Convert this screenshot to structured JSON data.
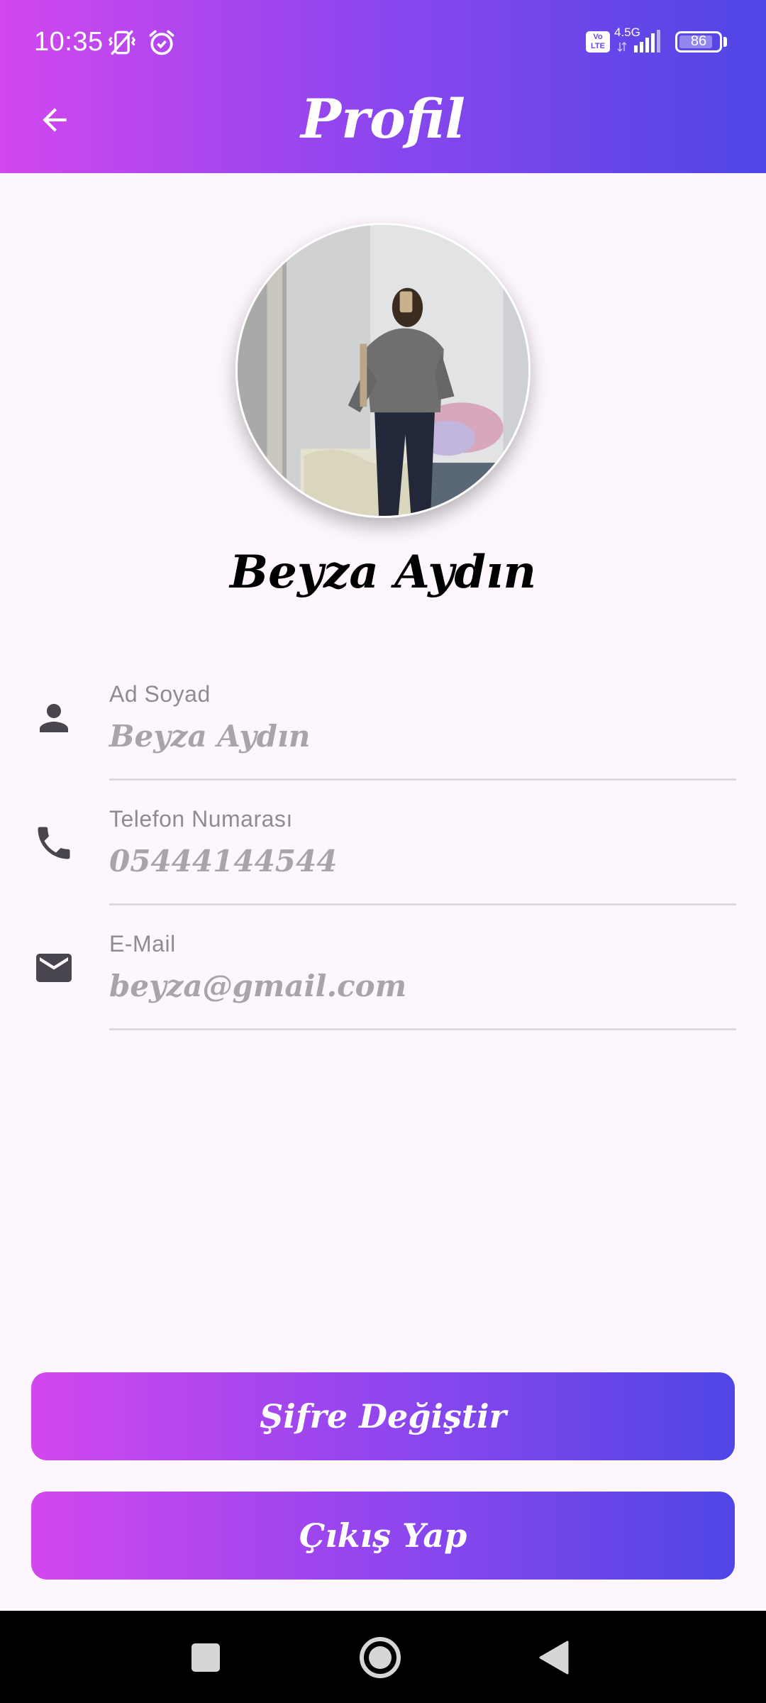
{
  "status_bar": {
    "time": "10:35",
    "network_badge": "Vo\nLTE",
    "network_type": "4.5G",
    "battery_level": 86,
    "battery_label": "86",
    "icons": [
      "vibrate-off-icon",
      "alarm-icon",
      "volte-icon",
      "signal-icon",
      "battery-icon"
    ]
  },
  "app_bar": {
    "title": "Profil",
    "back_icon": "arrow-left-icon"
  },
  "profile": {
    "name": "Beyza Aydın"
  },
  "fields": [
    {
      "icon": "person-icon",
      "label": "Ad Soyad",
      "value": "Beyza Aydın"
    },
    {
      "icon": "phone-icon",
      "label": "Telefon Numarası",
      "value": "05444144544"
    },
    {
      "icon": "mail-icon",
      "label": "E-Mail",
      "value": "beyza@gmail.com"
    }
  ],
  "buttons": {
    "change_password": "Şifre Değiştir",
    "logout": "Çıkış Yap"
  },
  "colors": {
    "gradient_start": "#d247ee",
    "gradient_mid": "#8b46ee",
    "gradient_end": "#4f46e5",
    "background": "#fdf7fd",
    "icon": "#48454e",
    "label": "#8f8a93",
    "value": "#a8a4ac"
  },
  "navigation_bar": {
    "icons": [
      "recents-square-icon",
      "home-circle-icon",
      "back-triangle-icon"
    ]
  }
}
